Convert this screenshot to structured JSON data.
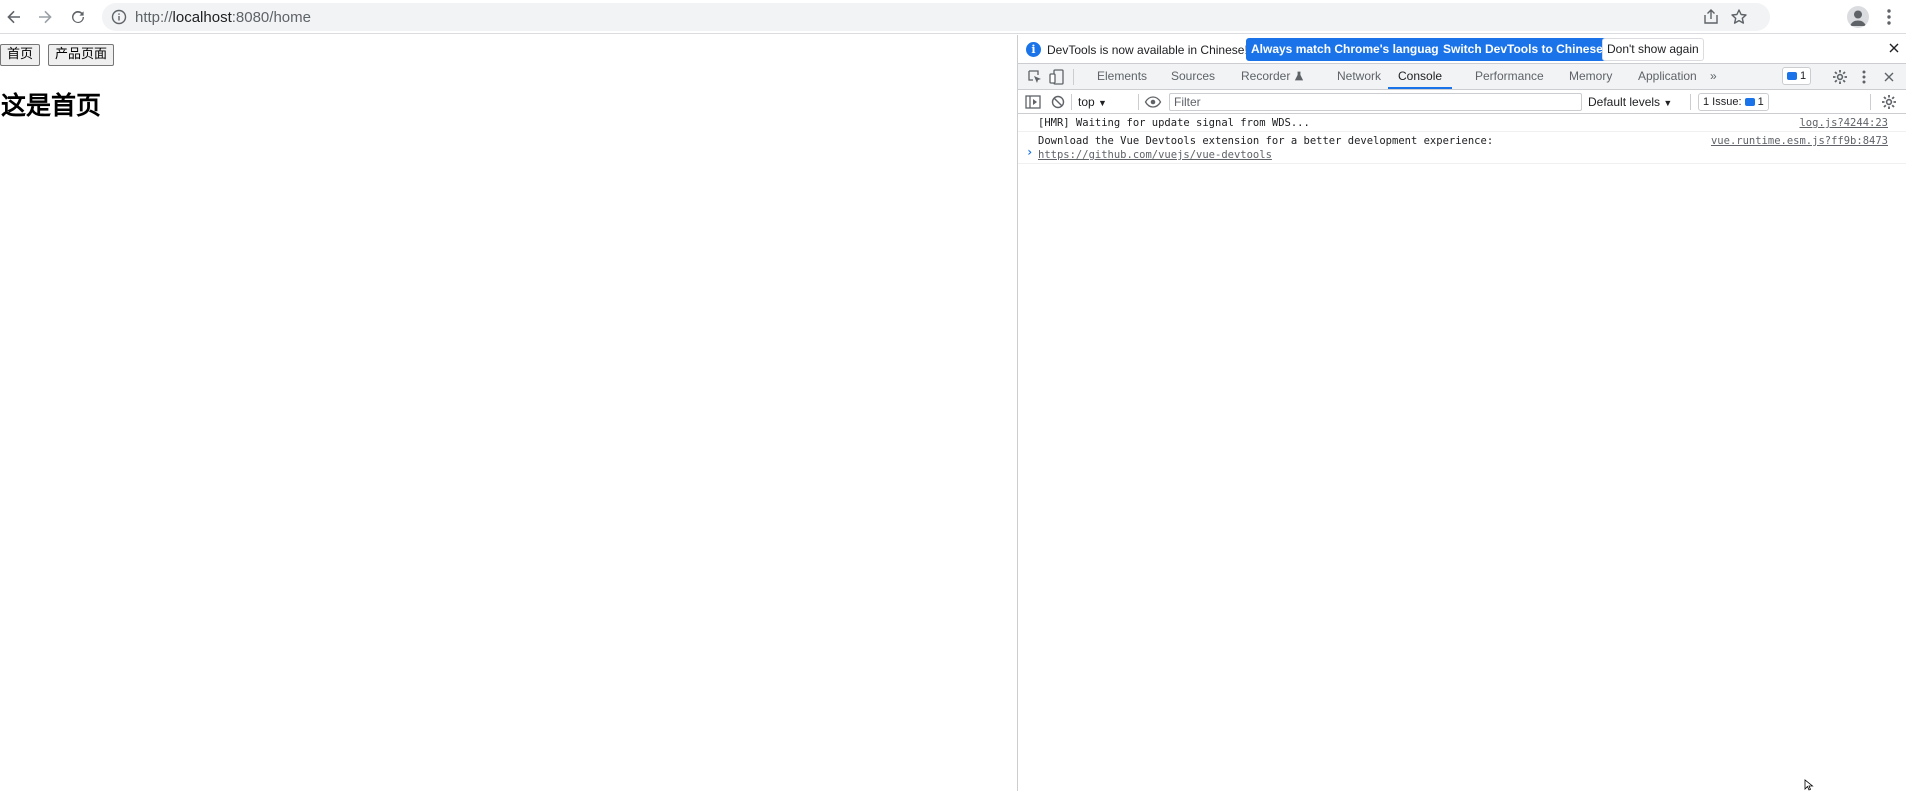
{
  "browser": {
    "url_scheme": "http://",
    "url_host": "localhost",
    "url_rest": ":8080/home",
    "icons": {
      "back": "arrow-left-icon",
      "forward": "arrow-right-icon",
      "reload": "reload-icon",
      "info": "info-icon",
      "share": "share-icon",
      "bookmark": "star-icon",
      "profile": "avatar-icon",
      "menu": "kebab-menu-icon"
    }
  },
  "page": {
    "buttons": [
      {
        "label": "首页"
      },
      {
        "label": "产品页面"
      }
    ],
    "heading": "这是首页"
  },
  "devtools": {
    "infobar": {
      "message": "DevTools is now available in Chinese!",
      "match_label": "Always match Chrome's language",
      "switch_label": "Switch DevTools to Chinese",
      "dismiss_label": "Don't show again"
    },
    "tabs": [
      {
        "label": "Elements"
      },
      {
        "label": "Sources"
      },
      {
        "label": "Recorder"
      },
      {
        "label": "Network"
      },
      {
        "label": "Console"
      },
      {
        "label": "Performance"
      },
      {
        "label": "Memory"
      },
      {
        "label": "Application"
      }
    ],
    "more_tabs": "»",
    "issues_count": "1",
    "toolbar": {
      "context": "top",
      "filter_placeholder": "Filter",
      "levels": "Default levels",
      "issues_label": "1 Issue:",
      "issues_count": "1"
    },
    "console": [
      {
        "text": "[HMR] Waiting for update signal from WDS...",
        "source": "log.js?4244:23"
      },
      {
        "text": "Download the Vue Devtools extension for a better development experience:",
        "link": "https://github.com/vuejs/vue-devtools",
        "source": "vue.runtime.esm.js?ff9b:8473"
      }
    ],
    "prompt": "›"
  },
  "colors": {
    "accent": "#1a73e8",
    "border": "#cbcdd1",
    "toolbar_bg": "#f1f3f4"
  }
}
